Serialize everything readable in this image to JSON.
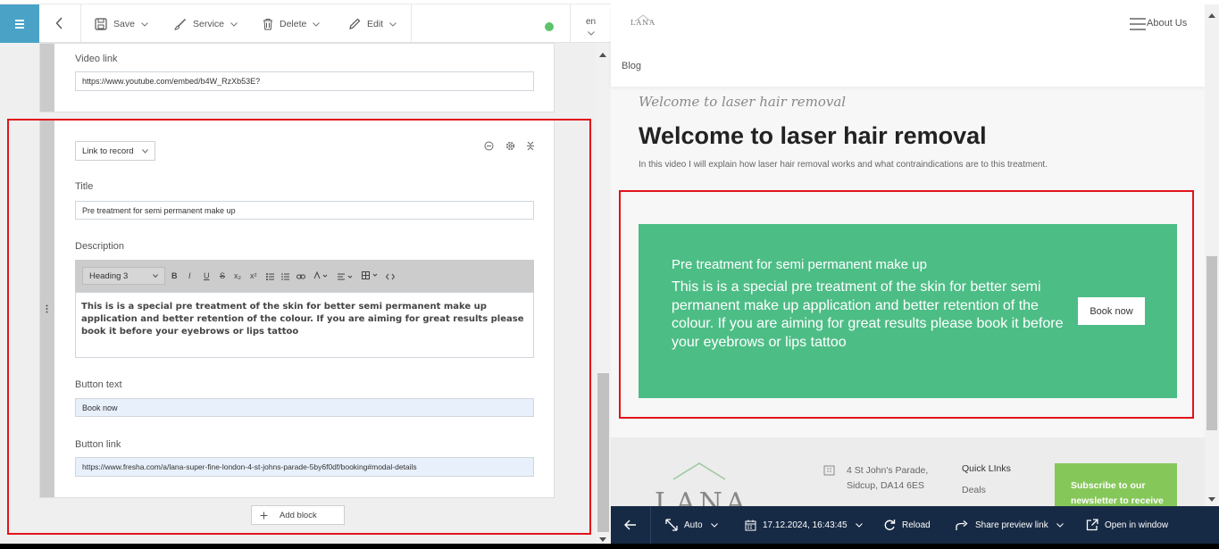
{
  "toolbar": {
    "save_label": "Save",
    "service_label": "Service",
    "delete_label": "Delete",
    "edit_label": "Edit",
    "language": "en",
    "status_color": "#5cc36a"
  },
  "editor": {
    "video_link_label": "Video link",
    "video_link_value": "https://www.youtube.com/embed/b4W_RzXb53E?",
    "block_type_selected": "Link to record",
    "title_label": "Title",
    "title_value": "Pre treatment for semi permanent make up",
    "description_label": "Description",
    "heading_select": "Heading 3",
    "description_text": "This is is a special pre treatment of the skin for better semi permanent make up application and better retention of the colour. If you are aiming for great results please book it before your eyebrows or lips tattoo",
    "button_text_label": "Button text",
    "button_text_value": "Book now",
    "button_link_label": "Button link",
    "button_link_value": "https://www.fresha.com/a/lana-super-fine-london-4-st-johns-parade-5by6f0df/booking#modal-details",
    "add_block_label": "Add block",
    "rte_buttons": [
      "B",
      "I",
      "U",
      "S",
      "x₂",
      "x²"
    ]
  },
  "preview": {
    "logo_text": "LANA",
    "nav_about": "About Us",
    "nav_blog": "Blog",
    "subtitle": "Welcome to laser hair removal",
    "title": "Welcome to laser hair removal",
    "description": "In this video I will explain how laser hair removal works and what contraindications are to this treatment.",
    "cta_title": "Pre treatment for semi permanent make up",
    "cta_text": "This is is a special pre treatment of the skin for better semi permanent make up application and better retention of the colour. If you are aiming for great results please book it before your eyebrows or lips tattoo",
    "cta_button": "Book now",
    "cta_color": "#4dbd86",
    "footer_address_line1": "4 St John's Parade,",
    "footer_address_line2": "Sidcup, DA14 6ES",
    "footer_quick_links": "Quick LInks",
    "footer_deals": "Deals",
    "footer_logo": "LANA",
    "subscribe_line1": "Subscribe to our",
    "subscribe_line2": "newsletter to receive"
  },
  "bottom_bar": {
    "viewport": "Auto",
    "datetime": "17.12.2024, 16:43:45",
    "reload": "Reload",
    "share": "Share preview link",
    "open_window": "Open in window",
    "color": "#172a45"
  }
}
